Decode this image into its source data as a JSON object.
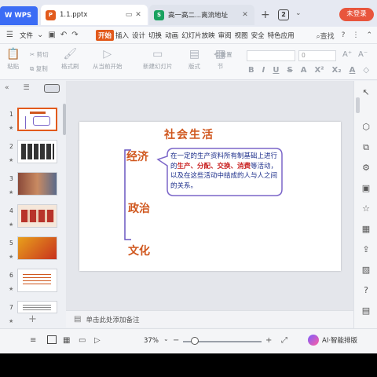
{
  "titlebar": {
    "wps_label": "WPS",
    "tabs": [
      {
        "label": "1.1.pptx",
        "icon_letter": "P",
        "color": "#e25a1c"
      },
      {
        "label": "高一高二...离流地址",
        "icon_letter": "S",
        "color": "#1aa260"
      }
    ],
    "add_tab": "+",
    "window_count": "2",
    "login_label": "未登录"
  },
  "menubar": {
    "file_label": "文件",
    "items": [
      "开始",
      "插入",
      "设计",
      "切换",
      "动画",
      "幻灯片放映",
      "审阅",
      "视图",
      "安全",
      "特色应用"
    ],
    "active_item": "开始",
    "search_label": "查找"
  },
  "ribbon": {
    "paste": "粘贴",
    "cut": "剪切",
    "copy": "复制",
    "format_painter": "格式刷",
    "from_current": "从当前开始",
    "new_slide": "新建幻灯片",
    "layout": "版式",
    "section": "节",
    "reset": "重置",
    "font_size_value": "0",
    "format_buttons": [
      "B",
      "I",
      "U",
      "S",
      "A",
      "X²",
      "X₂",
      "A",
      "◇"
    ]
  },
  "slides_panel": {
    "slide_numbers": [
      "1",
      "2",
      "3",
      "4",
      "5",
      "6",
      "7"
    ],
    "selected_slide": 1,
    "add_slide": "+"
  },
  "slide": {
    "title": "社会生活",
    "keywords": [
      "经济",
      "政治",
      "文化"
    ],
    "callout_parts": [
      {
        "text": "在一定的生产资料所有制基础上进行的",
        "highlight": false
      },
      {
        "text": "生产、分配、交换、消费",
        "highlight": true
      },
      {
        "text": "等活动，以及在这些活动中结成的人与人之间的关系。",
        "highlight": false
      }
    ],
    "colors": {
      "keyword": "#d0571e",
      "callout_border": "#7b66c9",
      "callout_text": "#1c2e8a",
      "highlight": "#c81e1e",
      "bracket": "#6a56c0"
    }
  },
  "notes": {
    "placeholder": "单击此处添加备注"
  },
  "statusbar": {
    "zoom": "37%",
    "zoom_fraction": 0.15,
    "ai_label": "AI·智能排版"
  }
}
